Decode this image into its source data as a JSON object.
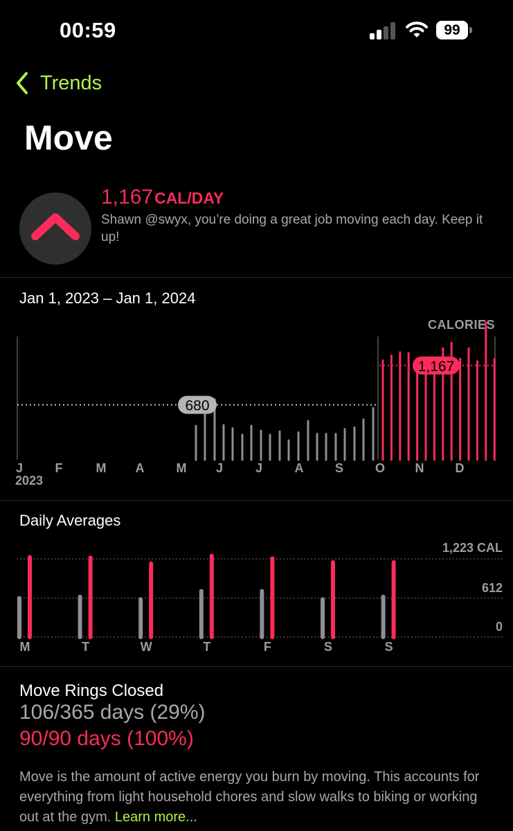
{
  "status": {
    "time": "00:59",
    "battery": "99"
  },
  "nav": {
    "back_label": "Trends"
  },
  "page": {
    "title": "Move"
  },
  "summary": {
    "value": "1,167",
    "unit": "CAL/DAY",
    "message": "Shawn @swyx, you’re doing a great job moving each day. Keep it up!",
    "trend": "up",
    "colors": {
      "accent": "#fa2c5a",
      "link": "#b3f04e",
      "gray": "#a8a8ad"
    }
  },
  "trend_chart": {
    "range": "Jan 1, 2023 – Jan 1, 2024",
    "unit_label": "CALORIES",
    "year_label": "2023",
    "avg_old": "680",
    "avg_new": "1,167"
  },
  "daily": {
    "title": "Daily Averages",
    "ticks": [
      "1,223 CAL",
      "612",
      "0"
    ]
  },
  "rings": {
    "title": "Move Rings Closed",
    "past": "106/365 days (29%)",
    "recent": "90/90 days (100%)"
  },
  "description": {
    "text": "Move is the amount of active energy you burn by moving. This accounts for everything from light household chores and slow walks to biking or working out at the gym.",
    "link": "Learn more..."
  },
  "chart_data": [
    {
      "type": "bar",
      "title": "",
      "ylabel": "CALORIES",
      "x_tick_labels": [
        "J",
        "F",
        "M",
        "A",
        "M",
        "J",
        "J",
        "A",
        "S",
        "O",
        "N",
        "D"
      ],
      "reference_lines": [
        {
          "label": "680",
          "value": 680,
          "series": "past"
        },
        {
          "label": "1,167",
          "value": 1167,
          "series": "recent"
        }
      ],
      "series": [
        {
          "name": "",
          "color": "#8e8e93",
          "x": [
            "May-4",
            "May-5",
            "Jun-1",
            "Jun-2",
            "Jun-3",
            "Jun-4",
            "Jul-1",
            "Jul-2",
            "Jul-3",
            "Jul-4",
            "Aug-1",
            "Aug-2",
            "Aug-3",
            "Aug-4",
            "Sep-1",
            "Sep-2",
            "Sep-3",
            "Sep-4",
            "Sep-5",
            "Oct-1"
          ],
          "values": [
            420,
            560,
            750,
            430,
            390,
            310,
            420,
            360,
            310,
            350,
            240,
            340,
            480,
            320,
            320,
            320,
            380,
            400,
            500,
            640
          ]
        },
        {
          "name": "",
          "color": "#fa2c5a",
          "x": [
            "Oct-2",
            "Oct-3",
            "Oct-4",
            "Oct-5",
            "Nov-1",
            "Nov-2",
            "Nov-3",
            "Nov-4",
            "Nov-5",
            "Dec-1",
            "Dec-2",
            "Dec-3",
            "Dec-4",
            "Dec-5"
          ],
          "values": [
            1230,
            1290,
            1330,
            1320,
            1230,
            1170,
            1230,
            1380,
            1450,
            1250,
            1380,
            1220,
            1700,
            1250
          ]
        }
      ]
    },
    {
      "type": "bar",
      "title": "Daily Averages",
      "categories": [
        "M",
        "T",
        "W",
        "T",
        "F",
        "S",
        "S"
      ],
      "ylim": [
        0,
        1223
      ],
      "ytick_labels": [
        "0",
        "612",
        "1,223 CAL"
      ],
      "series": [
        {
          "name": "",
          "color": "#8e8e93",
          "values": [
            610,
            630,
            590,
            720,
            720,
            590,
            630
          ]
        },
        {
          "name": "",
          "color": "#fa2c5a",
          "values": [
            1250,
            1240,
            1150,
            1270,
            1230,
            1170,
            1170
          ]
        }
      ]
    }
  ]
}
